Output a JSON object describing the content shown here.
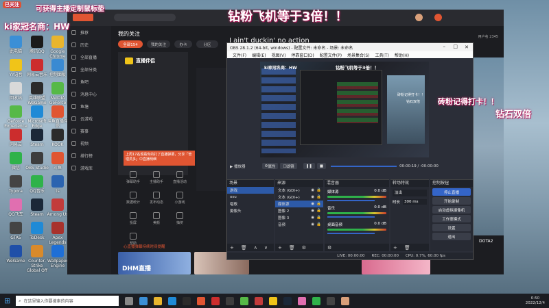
{
  "overlay": {
    "top_left_banner": "可获得主播定制鼠标垫",
    "top_left_small": "已关注",
    "family_name": "ki家冠名商：HW",
    "main_banner": "钻粉飞机等于3倍！！",
    "right_1": "砖粉记得打卡！！",
    "right_2": "钻石双倍"
  },
  "desktop_icons": [
    {
      "label": "此电脑",
      "color": "#3b8fd6"
    },
    {
      "label": "腾讯QQ",
      "color": "#1b1b1b"
    },
    {
      "label": "Google Chrome",
      "color": "#e8b52e"
    },
    {
      "label": "YY语音",
      "color": "#f0c419"
    },
    {
      "label": "网易云音乐",
      "color": "#cc2d2d"
    },
    {
      "label": "控制面板",
      "color": "#3a8ad2"
    },
    {
      "label": "回收站",
      "color": "#d9d9d9"
    },
    {
      "label": "英雄联盟 WeGame",
      "color": "#2b2b2b"
    },
    {
      "label": "NVIDIA GeForce",
      "color": "#56b947"
    },
    {
      "label": "GeForce Experience",
      "color": "#56b947"
    },
    {
      "label": "Microsoft Edge",
      "color": "#1f8ad6"
    },
    {
      "label": "斗鱼直播伴侣",
      "color": "#e05532"
    },
    {
      "label": "网易云",
      "color": "#cc2d2d"
    },
    {
      "label": "Steam",
      "color": "#1b2838"
    },
    {
      "label": "KOOK",
      "color": "#2b2b2b"
    },
    {
      "label": "微信",
      "color": "#2fb24a"
    },
    {
      "label": "OBS Studio",
      "color": "#3d3d3d"
    },
    {
      "label": "斗鱼",
      "color": "#e05532"
    },
    {
      "label": "Typora",
      "color": "#444"
    },
    {
      "label": "QQ音乐",
      "color": "#2fb24a"
    },
    {
      "label": "ts",
      "color": "#2b64b0"
    },
    {
      "label": "QQ飞车",
      "color": "#e06fb0"
    },
    {
      "label": "Steam",
      "color": "#1b2838"
    },
    {
      "label": "Among Us",
      "color": "#c23b3b"
    },
    {
      "label": "GTA5",
      "color": "#444"
    },
    {
      "label": "ToDesk",
      "color": "#1f8ad6"
    },
    {
      "label": "Apex Legends",
      "color": "#a8322d"
    },
    {
      "label": "WeGame",
      "color": "#1f4fa8"
    },
    {
      "label": "Counter-Strike Global Off",
      "color": "#d98a2b"
    },
    {
      "label": "Wallpaper Engine",
      "color": "#1f6fd6"
    }
  ],
  "douyu": {
    "my_follow": "我的关注",
    "stream_title": "I ain't duckin' no action",
    "tabs": [
      "全部154",
      "我的关注",
      "办卡",
      "分区"
    ],
    "nav": [
      "推荐",
      "历史",
      "全部直播",
      "全部分类",
      "鱼吧",
      "消息中心",
      "鱼塘",
      "云游戏",
      "赛事",
      "视频",
      "排行榜",
      "游戏库"
    ],
    "logo": "直播伴侣",
    "tip": "上周17名观看你的打了直播弹幕，分享「管理员多」中直播明细",
    "side_list": [
      "弹幕助手",
      "主播助手",
      "直播活动",
      "数据统计",
      "发布动态",
      "小游戏",
      "投屏",
      "美颜",
      "抽奖",
      "帮助"
    ],
    "bottom_tip": "心直播弹幕持续时间提醒",
    "right_user": "用户名 2345",
    "thumb_text": "DHM直播",
    "dota_label": "DOTA2"
  },
  "obs": {
    "title": "OBS 28.1.2 (64-bit, windows) - 配置文件: 未命名 - 场景: 未命名",
    "menu": [
      "文件(F)",
      "编辑(E)",
      "视图(V)",
      "停靠窗口(D)",
      "配置文件(P)",
      "场景集合(S)",
      "工具(T)",
      "帮助(H)"
    ],
    "player": {
      "play": "播放器",
      "props": "属性",
      "filters": "滤镜",
      "time": "00:00:19 / -00:00:00"
    },
    "scenes": {
      "title": "场景",
      "items": [
        "游戏",
        "osu",
        "唱歌",
        "摄像头"
      ]
    },
    "sources": {
      "title": "来源",
      "items": [
        "文本 (GDI+)",
        "文本 (GDI+)",
        "媒体源",
        "图像 2",
        "图像 3",
        "音频"
      ]
    },
    "mixer": {
      "title": "混音器",
      "channels": [
        {
          "name": "媒体源",
          "db": "0.0 dB"
        },
        {
          "name": "音乐",
          "db": "0.0 dB"
        },
        {
          "name": "桌面音频",
          "db": "0.0 dB"
        }
      ]
    },
    "transitions": {
      "title": "转场特效",
      "type": "淡出",
      "duration_label": "时长",
      "duration": "300 ms"
    },
    "controls": {
      "title": "控制按钮",
      "buttons": [
        "停止直播",
        "开始录制",
        "启动虚拟摄像机",
        "工作室模式",
        "设置",
        "退出"
      ]
    },
    "status": {
      "live": "LIVE: 00:00:00",
      "rec": "REC: 00:00:00",
      "cpu": "CPU: 0.7%, 60.00 fps"
    }
  },
  "taskbar": {
    "search_placeholder": "在这里输入你要搜索的内容",
    "time": "0:50",
    "date": "2022/12/4"
  }
}
